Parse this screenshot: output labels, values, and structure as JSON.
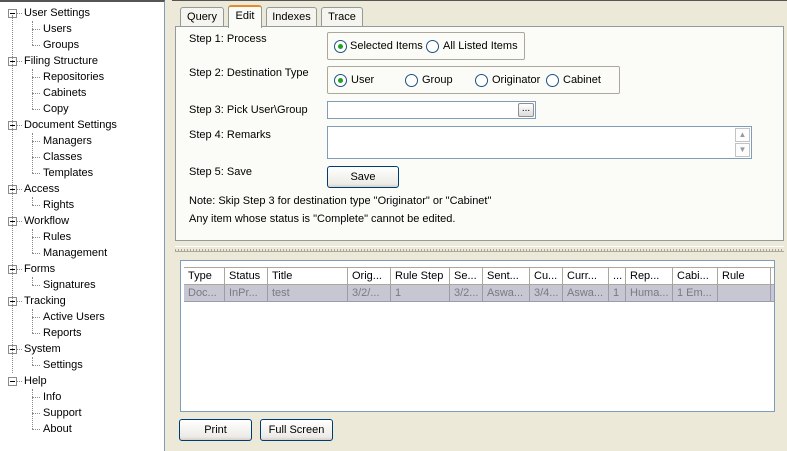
{
  "sidebar": {
    "categories": [
      {
        "label": "User Settings",
        "children": [
          "Users",
          "Groups"
        ]
      },
      {
        "label": "Filing Structure",
        "children": [
          "Repositories",
          "Cabinets",
          "Copy"
        ]
      },
      {
        "label": "Document Settings",
        "children": [
          "Managers",
          "Classes",
          "Templates"
        ]
      },
      {
        "label": "Access",
        "children": [
          "Rights"
        ]
      },
      {
        "label": "Workflow",
        "children": [
          "Rules",
          "Management"
        ]
      },
      {
        "label": "Forms",
        "children": [
          "Signatures"
        ]
      },
      {
        "label": "Tracking",
        "children": [
          "Active Users",
          "Reports"
        ]
      },
      {
        "label": "System",
        "children": [
          "Settings"
        ]
      },
      {
        "label": "Help",
        "children": [
          "Info",
          "Support",
          "About"
        ]
      }
    ]
  },
  "tabs": [
    "Query",
    "Edit",
    "Indexes",
    "Trace"
  ],
  "active_tab": "Edit",
  "edit": {
    "step1": {
      "label": "Step 1: Process",
      "options": [
        "Selected Items",
        "All Listed Items"
      ],
      "selected": "Selected Items"
    },
    "step2": {
      "label": "Step 2: Destination Type",
      "options": [
        "User",
        "Group",
        "Originator",
        "Cabinet"
      ],
      "selected": "User"
    },
    "step3": {
      "label": "Step 3: Pick User\\Group",
      "value": "",
      "browse_label": "..."
    },
    "step4": {
      "label": "Step 4: Remarks",
      "value": ""
    },
    "step5": {
      "label": "Step 5: Save",
      "button": "Save"
    },
    "note1": "Note: Skip Step 3 for destination type \"Originator\" or \"Cabinet\"",
    "note2": "Any item whose status is \"Complete\" cannot be edited."
  },
  "grid": {
    "columns": [
      "Type",
      "Status",
      "Title",
      "Orig...",
      "Rule Step",
      "Se...",
      "Sent...",
      "Cu...",
      "Curr...",
      "...",
      "Rep...",
      "Cabi...",
      "Rule"
    ],
    "rows": [
      [
        "Doc...",
        "InPr...",
        "test",
        "3/2/...",
        "1",
        "3/2...",
        "Aswa...",
        "3/4...",
        "Aswa...",
        "1",
        "Huma...",
        "1 Em...",
        ""
      ]
    ]
  },
  "footer": {
    "print": "Print",
    "full_screen": "Full Screen"
  },
  "colors": {
    "selected_row": "#c7c7d3",
    "radio_dot": "#21a121",
    "tab_accent": "#e68b2c"
  }
}
